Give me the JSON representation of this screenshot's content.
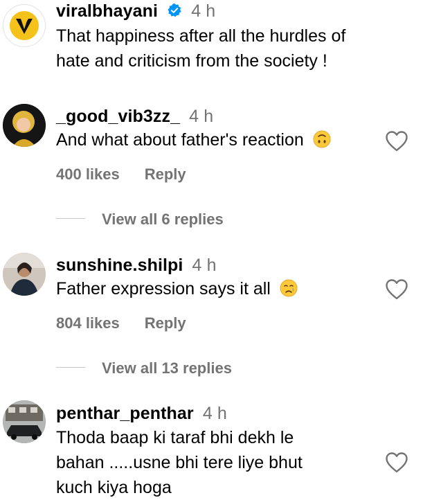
{
  "comments": [
    {
      "username": "viralbhayani",
      "time": "4 h",
      "verified": true,
      "text_lines": [
        "That happiness after all the hurdles of",
        "hate and criticism from the society !"
      ]
    },
    {
      "username": "_good_vib3zz_",
      "time": "4 h",
      "text": "And what about father's reaction",
      "emoji": "upside-down-face",
      "likes": "400 likes",
      "reply": "Reply",
      "view_replies": "View all 6 replies"
    },
    {
      "username": "sunshine.shilpi",
      "time": "4 h",
      "text": "Father expression says it all",
      "emoji": "crying-face",
      "likes": "804 likes",
      "reply": "Reply",
      "view_replies": "View all 13 replies"
    },
    {
      "username": "penthar_penthar",
      "time": "4 h",
      "text_lines": [
        "Thoda baap ki taraf bhi dekh le",
        "bahan .....usne bhi tere liye bhut",
        "kuch kiya hoga"
      ]
    }
  ],
  "colors": {
    "secondary_text": "#737373",
    "verified_blue": "#0095f6",
    "brand_yellow": "#f5c21b"
  }
}
